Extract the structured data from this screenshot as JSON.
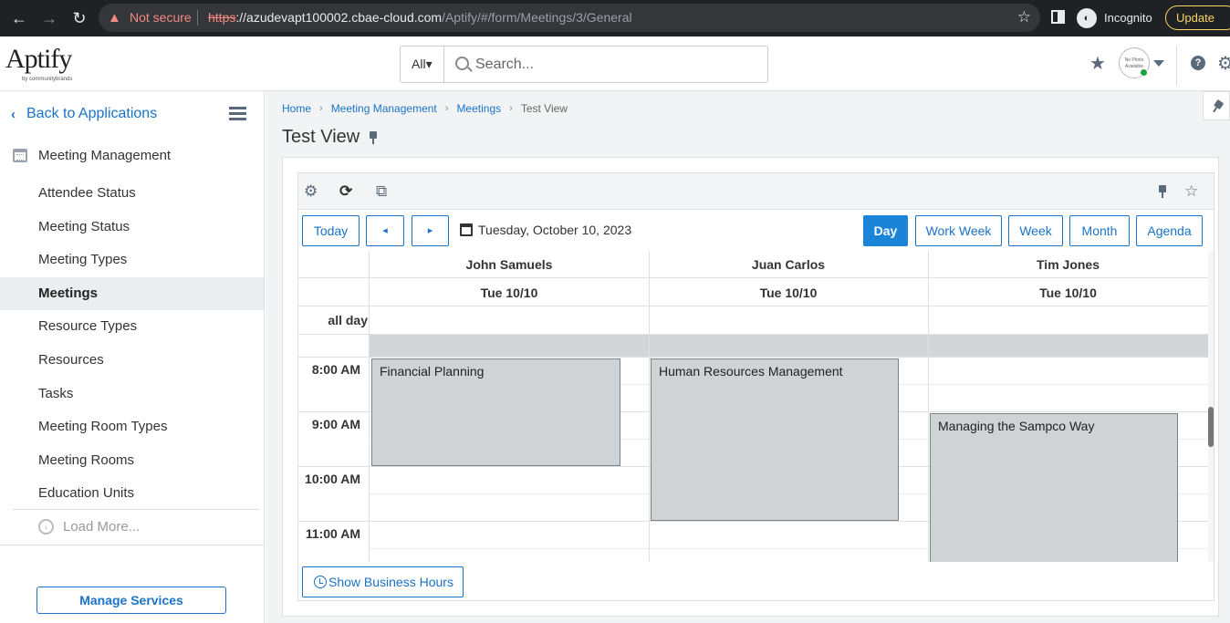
{
  "browser": {
    "not_secure": "Not secure",
    "url_scheme": "https",
    "url_host": "://azudevapt100002.cbae-cloud.com",
    "url_path": "/Aptify/#/form/Meetings/3/General",
    "incognito": "Incognito",
    "update": "Update"
  },
  "header": {
    "logo": "Aptify",
    "logo_tag": "by communitybrands",
    "search_scope": "All",
    "search_placeholder": "Search...",
    "avatar_text": "No Photo Available"
  },
  "sidebar": {
    "back_label": "Back to Applications",
    "section_title": "Meeting Management",
    "items": [
      {
        "label": "Attendee Status",
        "active": false
      },
      {
        "label": "Meeting Status",
        "active": false
      },
      {
        "label": "Meeting Types",
        "active": false
      },
      {
        "label": "Meetings",
        "active": true
      },
      {
        "label": "Resource Types",
        "active": false
      },
      {
        "label": "Resources",
        "active": false
      },
      {
        "label": "Tasks",
        "active": false
      },
      {
        "label": "Meeting Room Types",
        "active": false
      },
      {
        "label": "Meeting Rooms",
        "active": false
      },
      {
        "label": "Education Units",
        "active": false
      }
    ],
    "load_more": "Load More...",
    "manage_services": "Manage Services"
  },
  "breadcrumb": [
    "Home",
    "Meeting Management",
    "Meetings",
    "Test View"
  ],
  "page_title": "Test View",
  "calendar": {
    "nav": {
      "today": "Today",
      "prev": "◂",
      "next": "▸"
    },
    "date_label": "Tuesday, October 10, 2023",
    "views": [
      {
        "label": "Day",
        "active": true
      },
      {
        "label": "Work Week",
        "active": false
      },
      {
        "label": "Week",
        "active": false
      },
      {
        "label": "Month",
        "active": false
      },
      {
        "label": "Agenda",
        "active": false
      }
    ],
    "resources": [
      {
        "name": "John Samuels",
        "date": "Tue 10/10"
      },
      {
        "name": "Juan Carlos",
        "date": "Tue 10/10"
      },
      {
        "name": "Tim Jones",
        "date": "Tue 10/10"
      }
    ],
    "all_day_label": "all day",
    "times": [
      "8:00 AM",
      "9:00 AM",
      "10:00 AM",
      "11:00 AM"
    ],
    "events": [
      {
        "title": "Financial Planning",
        "resource": 0,
        "start": "8:00 AM",
        "end": "10:00 AM"
      },
      {
        "title": "Human Resources Management",
        "resource": 1,
        "start": "8:00 AM",
        "end": "11:00 AM"
      },
      {
        "title": "Managing the Sampco Way",
        "resource": 2,
        "start": "9:00 AM",
        "end": "11:30 AM"
      }
    ],
    "business_hours": "Show Business Hours"
  },
  "colors": {
    "accent": "#1a73c8",
    "event_bg": "#cfd3d6",
    "active_view": "#1a84d8"
  }
}
